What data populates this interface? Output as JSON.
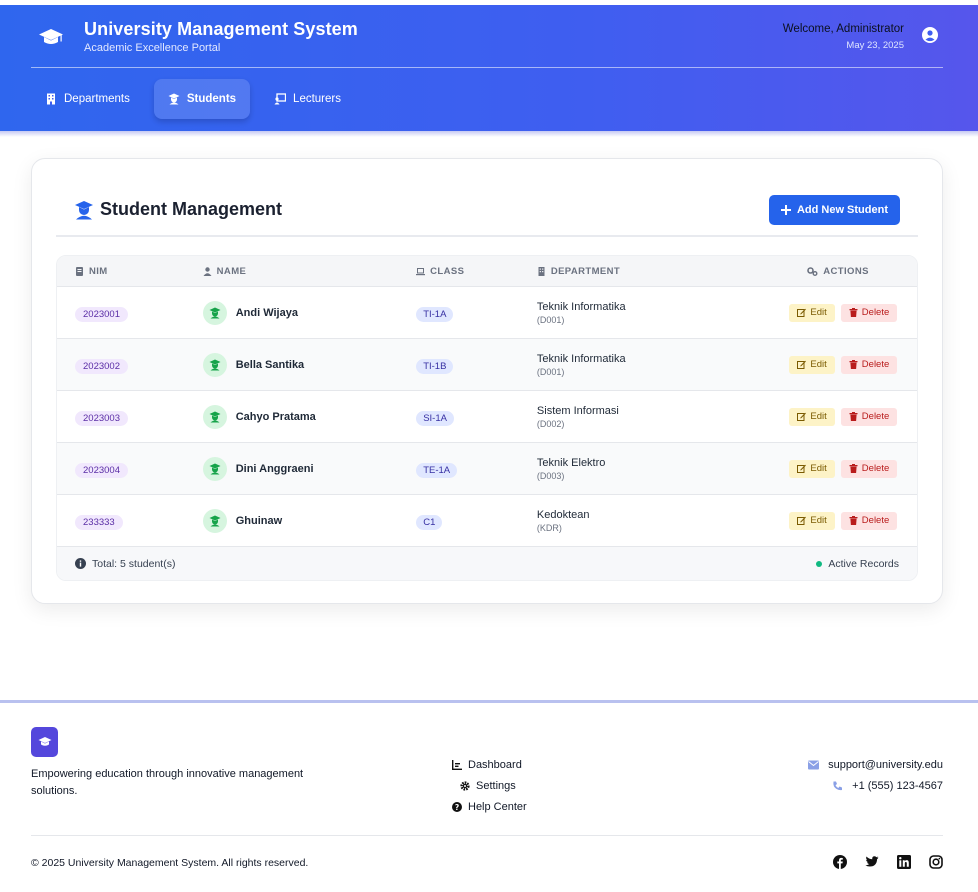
{
  "header": {
    "title": "University Management System",
    "subtitle": "Academic Excellence Portal",
    "welcome": "Welcome, Administrator",
    "date": "May 23, 2025"
  },
  "nav": {
    "items": [
      {
        "label": "Departments",
        "icon": "building-icon"
      },
      {
        "label": "Students",
        "icon": "graduate-icon",
        "active": true
      },
      {
        "label": "Lecturers",
        "icon": "chalkboard-teacher-icon"
      }
    ]
  },
  "page": {
    "title": "Student Management",
    "add_label": "Add New Student"
  },
  "table": {
    "headers": {
      "nim": "NIM",
      "name": "NAME",
      "class": "CLASS",
      "department": "DEPARTMENT",
      "actions": "ACTIONS"
    },
    "rows": [
      {
        "nim": "2023001",
        "name": "Andi Wijaya",
        "class": "TI-1A",
        "dept": "Teknik Informatika",
        "code": "(D001)"
      },
      {
        "nim": "2023002",
        "name": "Bella Santika",
        "class": "TI-1B",
        "dept": "Teknik Informatika",
        "code": "(D001)"
      },
      {
        "nim": "2023003",
        "name": "Cahyo Pratama",
        "class": "SI-1A",
        "dept": "Sistem Informasi",
        "code": "(D002)"
      },
      {
        "nim": "2023004",
        "name": "Dini Anggraeni",
        "class": "TE-1A",
        "dept": "Teknik Elektro",
        "code": "(D003)"
      },
      {
        "nim": "233333",
        "name": "Ghuinaw",
        "class": "C1",
        "dept": "Kedoktean",
        "code": "(KDR)"
      }
    ],
    "edit_label": "Edit",
    "delete_label": "Delete",
    "total": "Total: 5 student(s)",
    "status": "Active Records"
  },
  "footer": {
    "tagline": "Empowering education through innovative management solutions.",
    "links": [
      "Dashboard",
      "Settings",
      "Help Center"
    ],
    "email": "support@university.edu",
    "phone": "+1 (555) 123-4567",
    "copyright": "© 2025 University Management System. All rights reserved.",
    "social": [
      "facebook-icon",
      "twitter-icon",
      "linkedin-icon",
      "instagram-icon"
    ]
  },
  "colors": {
    "header_start": "#2f66ee",
    "header_end": "#5656ec",
    "primary": "#2563eb",
    "nim_badge": "#f1e8fd",
    "class_badge": "#e0e7ff",
    "edit": "#fdf3c7",
    "delete": "#fde2e2",
    "active_dot": "#10b981"
  }
}
